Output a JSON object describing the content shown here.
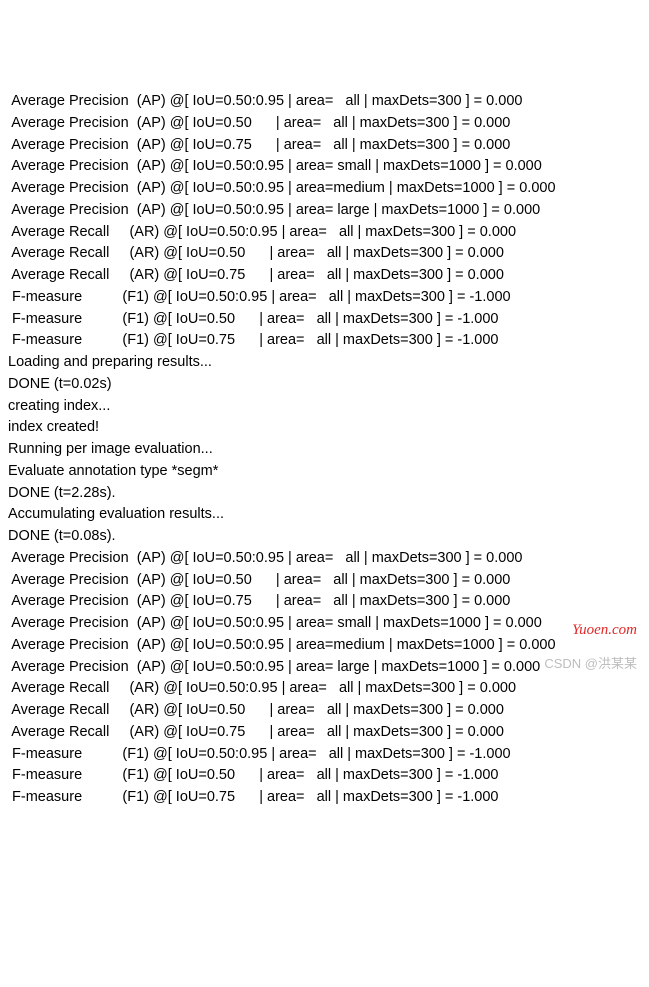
{
  "lines": [
    " Average Precision  (AP) @[ IoU=0.50:0.95 | area=   all | maxDets=300 ] = 0.000",
    " Average Precision  (AP) @[ IoU=0.50      | area=   all | maxDets=300 ] = 0.000",
    " Average Precision  (AP) @[ IoU=0.75      | area=   all | maxDets=300 ] = 0.000",
    " Average Precision  (AP) @[ IoU=0.50:0.95 | area= small | maxDets=1000 ] = 0.000",
    " Average Precision  (AP) @[ IoU=0.50:0.95 | area=medium | maxDets=1000 ] = 0.000",
    " Average Precision  (AP) @[ IoU=0.50:0.95 | area= large | maxDets=1000 ] = 0.000",
    " Average Recall     (AR) @[ IoU=0.50:0.95 | area=   all | maxDets=300 ] = 0.000",
    " Average Recall     (AR) @[ IoU=0.50      | area=   all | maxDets=300 ] = 0.000",
    " Average Recall     (AR) @[ IoU=0.75      | area=   all | maxDets=300 ] = 0.000",
    " F-measure          (F1) @[ IoU=0.50:0.95 | area=   all | maxDets=300 ] = -1.000",
    " F-measure          (F1) @[ IoU=0.50      | area=   all | maxDets=300 ] = -1.000",
    " F-measure          (F1) @[ IoU=0.75      | area=   all | maxDets=300 ] = -1.000",
    "Loading and preparing results...",
    "DONE (t=0.02s)",
    "creating index...",
    "index created!",
    "Running per image evaluation...",
    "Evaluate annotation type *segm*",
    "DONE (t=2.28s).",
    "Accumulating evaluation results...",
    "DONE (t=0.08s).",
    " Average Precision  (AP) @[ IoU=0.50:0.95 | area=   all | maxDets=300 ] = 0.000",
    " Average Precision  (AP) @[ IoU=0.50      | area=   all | maxDets=300 ] = 0.000",
    " Average Precision  (AP) @[ IoU=0.75      | area=   all | maxDets=300 ] = 0.000",
    " Average Precision  (AP) @[ IoU=0.50:0.95 | area= small | maxDets=1000 ] = 0.000",
    " Average Precision  (AP) @[ IoU=0.50:0.95 | area=medium | maxDets=1000 ] = 0.000",
    " Average Precision  (AP) @[ IoU=0.50:0.95 | area= large | maxDets=1000 ] = 0.000",
    " Average Recall     (AR) @[ IoU=0.50:0.95 | area=   all | maxDets=300 ] = 0.000",
    " Average Recall     (AR) @[ IoU=0.50      | area=   all | maxDets=300 ] = 0.000",
    " Average Recall     (AR) @[ IoU=0.75      | area=   all | maxDets=300 ] = 0.000",
    " F-measure          (F1) @[ IoU=0.50:0.95 | area=   all | maxDets=300 ] = -1.000",
    " F-measure          (F1) @[ IoU=0.50      | area=   all | maxDets=300 ] = -1.000",
    " F-measure          (F1) @[ IoU=0.75      | area=   all | maxDets=300 ] = -1.000"
  ],
  "watermark1": "Yuoen.com",
  "watermark2": "CSDN @洪某某"
}
